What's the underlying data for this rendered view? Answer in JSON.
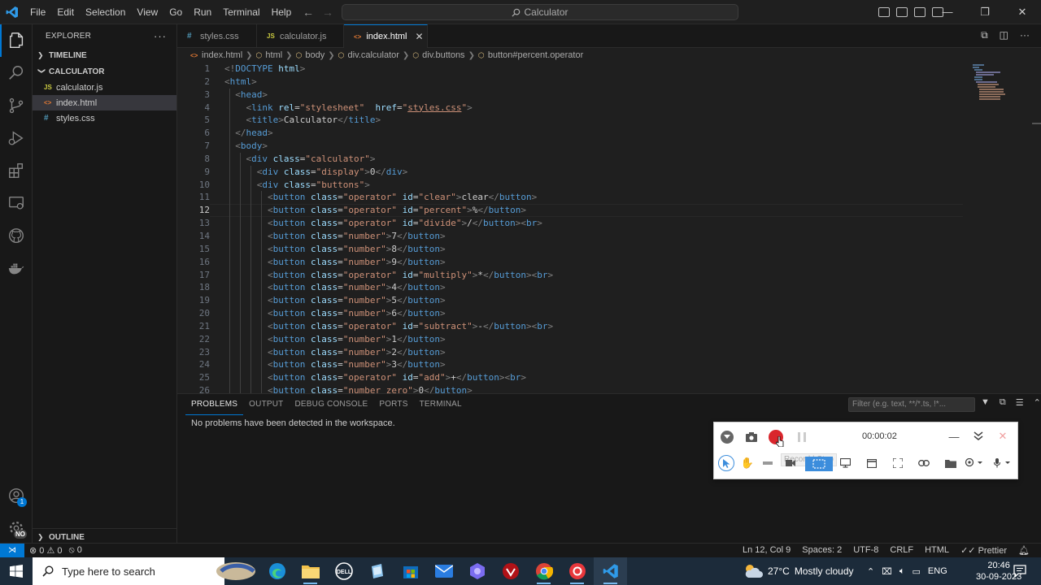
{
  "titlebar": {
    "menu": [
      "File",
      "Edit",
      "Selection",
      "View",
      "Go",
      "Run",
      "Terminal",
      "Help"
    ],
    "command_center": "Calculator"
  },
  "sidebar": {
    "header": "EXPLORER",
    "timeline": "TIMELINE",
    "folder": "CALCULATOR",
    "files": [
      {
        "name": "calculator.js",
        "type": "JS"
      },
      {
        "name": "index.html",
        "type": "<>"
      },
      {
        "name": "styles.css",
        "type": "#"
      }
    ],
    "outline": "OUTLINE"
  },
  "tabs": [
    {
      "label": "styles.css",
      "type": "#"
    },
    {
      "label": "calculator.js",
      "type": "JS"
    },
    {
      "label": "index.html",
      "type": "<>"
    }
  ],
  "breadcrumb": [
    "index.html",
    "html",
    "body",
    "div.calculator",
    "div.buttons",
    "button#percent.operator"
  ],
  "editor": {
    "current_line": 12,
    "line_numbers": [
      "1",
      "2",
      "3",
      "4",
      "5",
      "6",
      "7",
      "8",
      "9",
      "10",
      "11",
      "12",
      "13",
      "14",
      "15",
      "16",
      "17",
      "18",
      "19",
      "20",
      "21",
      "22",
      "23",
      "24",
      "25",
      "26"
    ]
  },
  "panel": {
    "tabs": [
      "PROBLEMS",
      "OUTPUT",
      "DEBUG CONSOLE",
      "PORTS",
      "TERMINAL"
    ],
    "filter_placeholder": "Filter (e.g. text, **/*.ts, !*...",
    "message": "No problems have been detected in the workspace."
  },
  "recorder": {
    "timer": "00:00:02",
    "tooltip": "Record | Stop"
  },
  "statusbar": {
    "errors": "0",
    "warnings": "0",
    "ports": "0",
    "position": "Ln 12, Col 9",
    "spaces": "Spaces: 2",
    "encoding": "UTF-8",
    "eol": "CRLF",
    "language": "HTML",
    "formatter": "Prettier"
  },
  "taskbar": {
    "search_placeholder": "Type here to search",
    "weather_temp": "27°C",
    "weather_desc": "Mostly cloudy",
    "language": "ENG",
    "time": "20:46",
    "date": "30-09-2023"
  },
  "colors": {
    "accent": "#0078d4",
    "tag": "#569cd6",
    "attribute": "#9cdcfe",
    "string": "#ce9178",
    "record_red": "#d9262c"
  }
}
